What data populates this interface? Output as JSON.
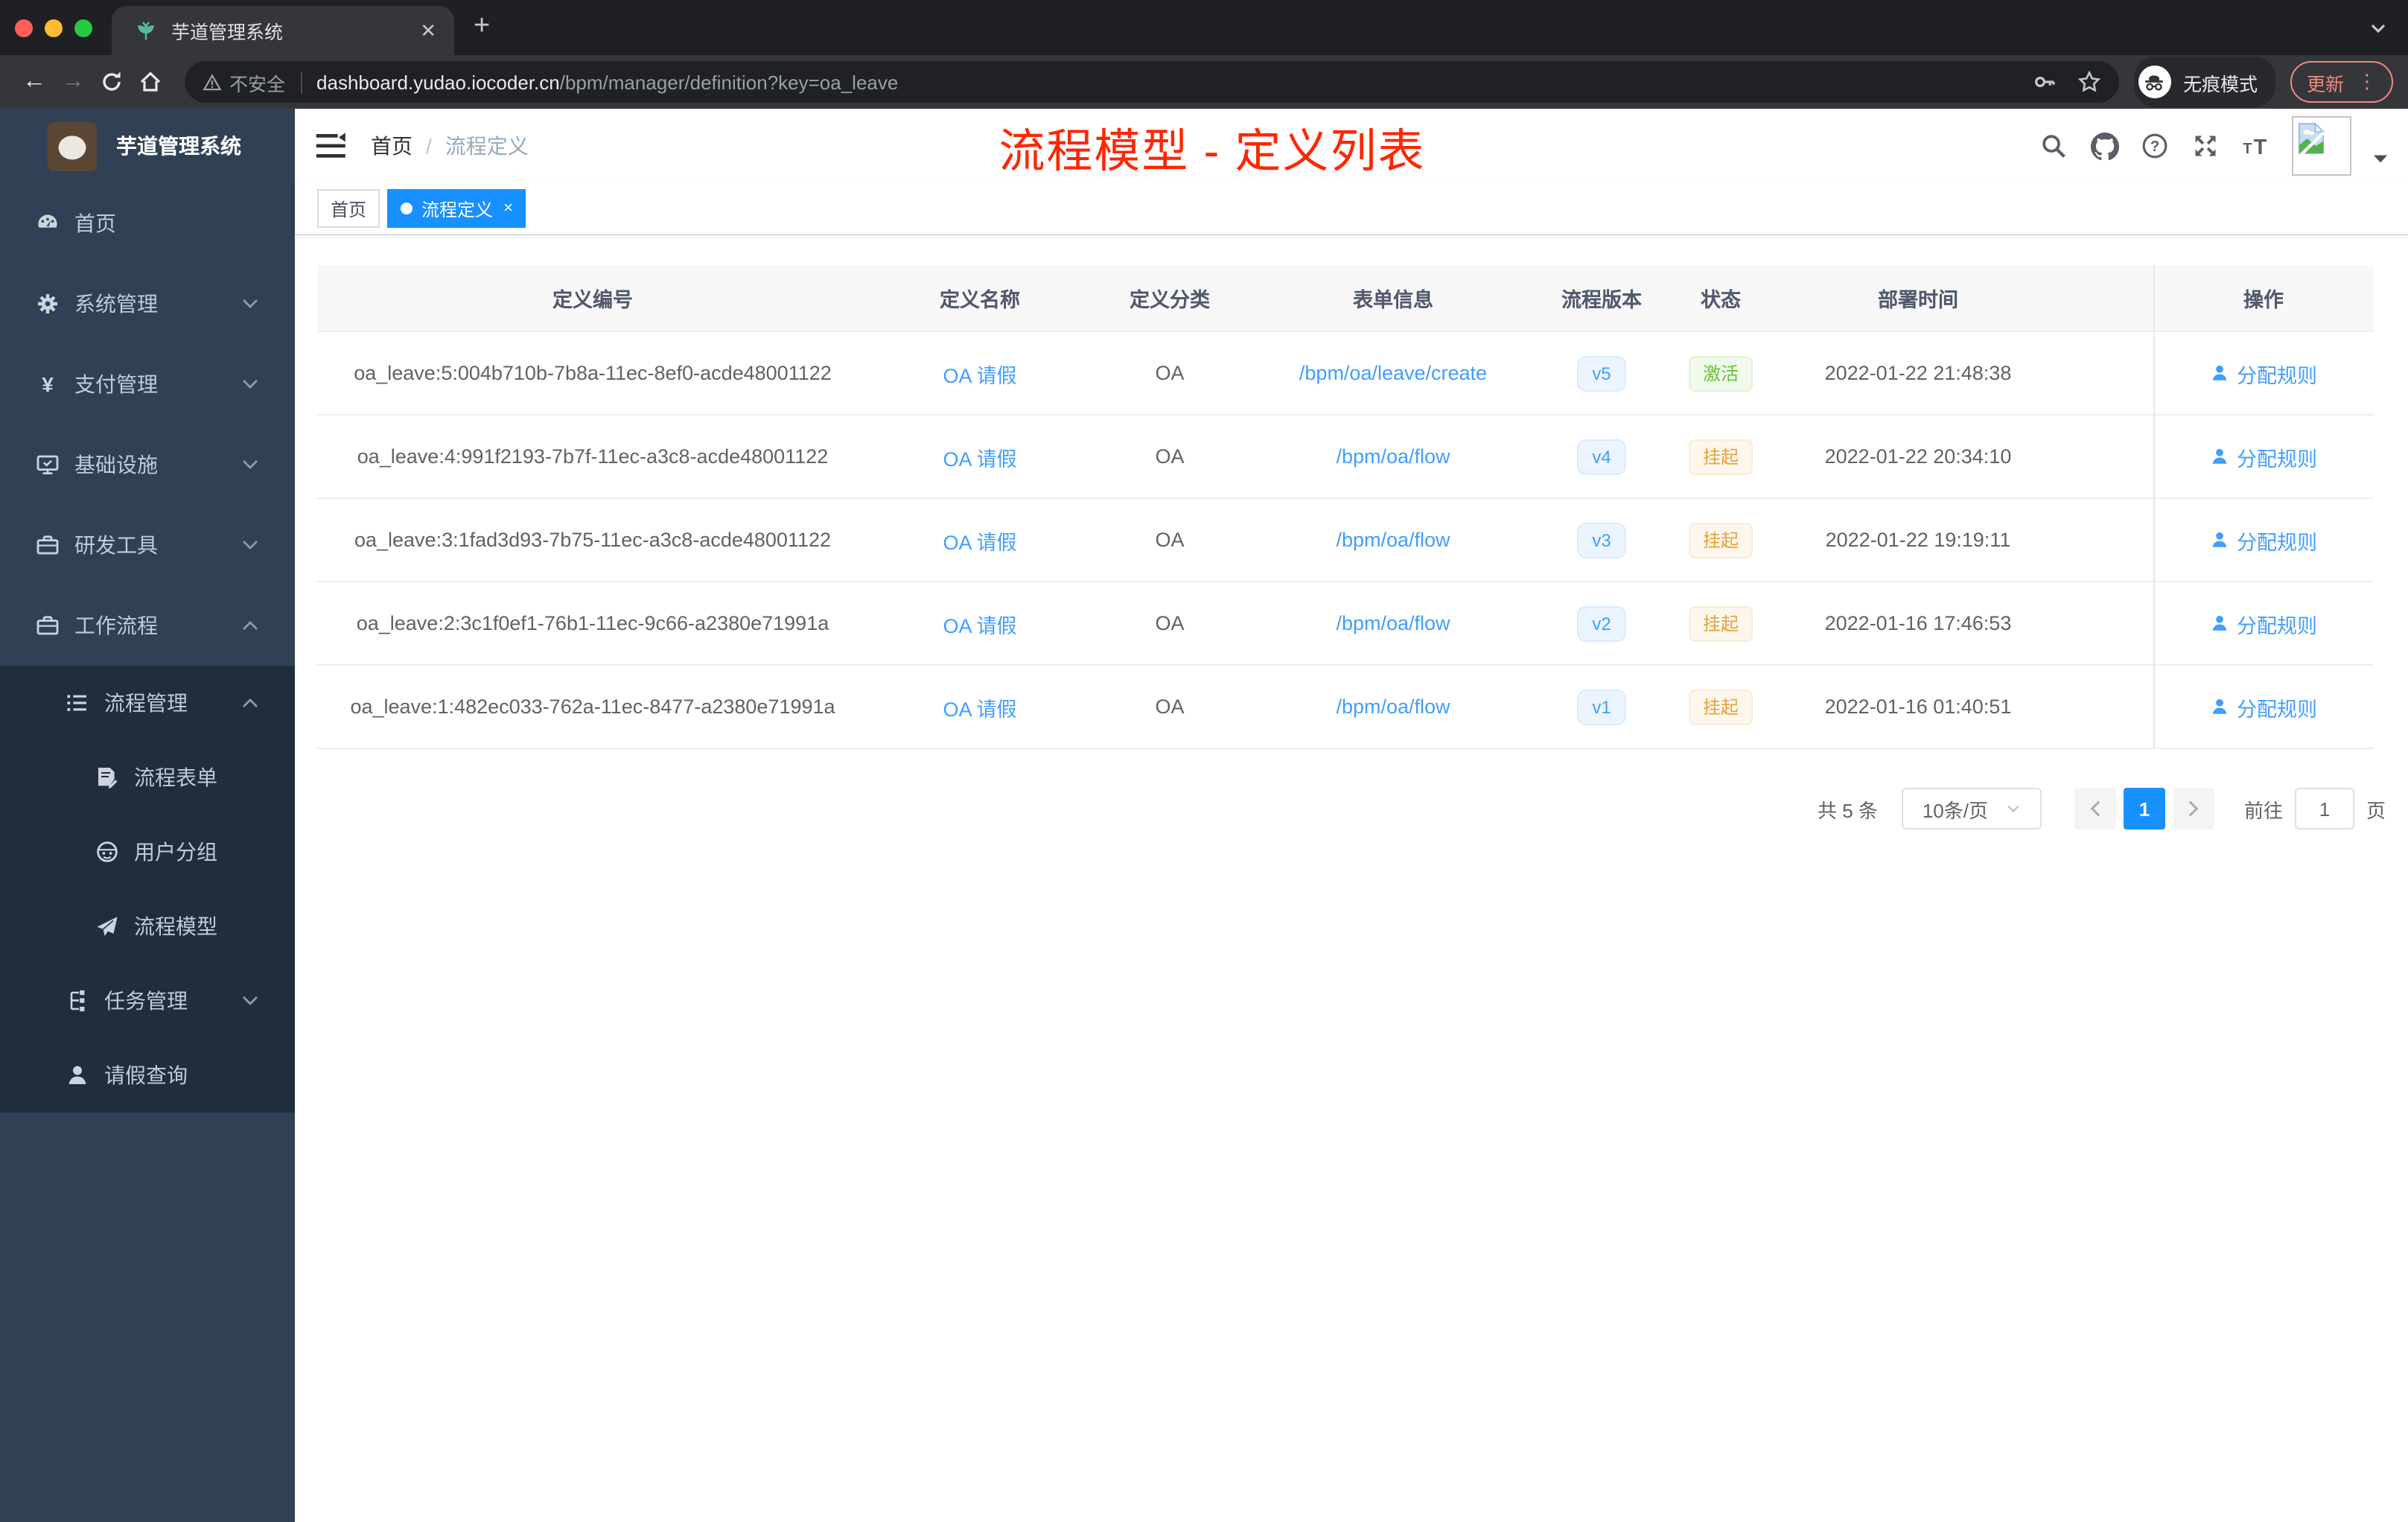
{
  "browser": {
    "tab_title": "芋道管理系统",
    "security_label": "不安全",
    "url_host": "dashboard.yudao.iocoder.cn",
    "url_path": "/bpm/manager/definition?key=oa_leave",
    "incognito_label": "无痕模式",
    "update_label": "更新"
  },
  "sidebar": {
    "app_title": "芋道管理系统",
    "items": [
      {
        "key": "home",
        "label": "首页",
        "icon": "dashboard-icon",
        "depth": 0,
        "sub": false,
        "chevron": null
      },
      {
        "key": "system-management",
        "label": "系统管理",
        "icon": "gear-icon",
        "depth": 0,
        "sub": false,
        "chevron": "down"
      },
      {
        "key": "payment-management",
        "label": "支付管理",
        "icon": "yen-icon",
        "depth": 0,
        "sub": false,
        "chevron": "down"
      },
      {
        "key": "infrastructure",
        "label": "基础设施",
        "icon": "monitor-icon",
        "depth": 0,
        "sub": false,
        "chevron": "down"
      },
      {
        "key": "dev-tools",
        "label": "研发工具",
        "icon": "toolbox-icon",
        "depth": 0,
        "sub": false,
        "chevron": "down"
      },
      {
        "key": "workflow",
        "label": "工作流程",
        "icon": "toolbox-icon",
        "depth": 0,
        "sub": false,
        "chevron": "up"
      },
      {
        "key": "process-management",
        "label": "流程管理",
        "icon": "list-tree-icon",
        "depth": 1,
        "sub": true,
        "chevron": "up"
      },
      {
        "key": "process-form",
        "label": "流程表单",
        "icon": "form-icon",
        "depth": 2,
        "sub": true,
        "chevron": null
      },
      {
        "key": "user-group",
        "label": "用户分组",
        "icon": "robot-icon",
        "depth": 2,
        "sub": true,
        "chevron": null
      },
      {
        "key": "process-model",
        "label": "流程模型",
        "icon": "paper-plane-icon",
        "depth": 2,
        "sub": true,
        "chevron": null
      },
      {
        "key": "task-management",
        "label": "任务管理",
        "icon": "org-tree-icon",
        "depth": 1,
        "sub": true,
        "chevron": "down"
      },
      {
        "key": "leave-query",
        "label": "请假查询",
        "icon": "person-icon",
        "depth": 1,
        "sub": true,
        "chevron": null
      }
    ]
  },
  "navbar": {
    "breadcrumb": {
      "home": "首页",
      "separator": "/",
      "current": "流程定义"
    },
    "page_banner": "流程模型 - 定义列表"
  },
  "tags": [
    {
      "label": "首页",
      "active": false,
      "closable": false
    },
    {
      "label": "流程定义",
      "active": true,
      "closable": true
    }
  ],
  "table": {
    "columns": [
      "定义编号",
      "定义名称",
      "定义分类",
      "表单信息",
      "流程版本",
      "状态",
      "部署时间",
      "操作"
    ],
    "action_label": "分配规则",
    "rows": [
      {
        "id": "oa_leave:5:004b710b-7b8a-11ec-8ef0-acde48001122",
        "name": "OA 请假",
        "category": "OA",
        "form": "/bpm/oa/leave/create",
        "version": "v5",
        "status": "激活",
        "status_type": "success",
        "deploy_time": "2022-01-22 21:48:38"
      },
      {
        "id": "oa_leave:4:991f2193-7b7f-11ec-a3c8-acde48001122",
        "name": "OA 请假",
        "category": "OA",
        "form": "/bpm/oa/flow",
        "version": "v4",
        "status": "挂起",
        "status_type": "warning",
        "deploy_time": "2022-01-22 20:34:10"
      },
      {
        "id": "oa_leave:3:1fad3d93-7b75-11ec-a3c8-acde48001122",
        "name": "OA 请假",
        "category": "OA",
        "form": "/bpm/oa/flow",
        "version": "v3",
        "status": "挂起",
        "status_type": "warning",
        "deploy_time": "2022-01-22 19:19:11"
      },
      {
        "id": "oa_leave:2:3c1f0ef1-76b1-11ec-9c66-a2380e71991a",
        "name": "OA 请假",
        "category": "OA",
        "form": "/bpm/oa/flow",
        "version": "v2",
        "status": "挂起",
        "status_type": "warning",
        "deploy_time": "2022-01-16 17:46:53"
      },
      {
        "id": "oa_leave:1:482ec033-762a-11ec-8477-a2380e71991a",
        "name": "OA 请假",
        "category": "OA",
        "form": "/bpm/oa/flow",
        "version": "v1",
        "status": "挂起",
        "status_type": "warning",
        "deploy_time": "2022-01-16 01:40:51"
      }
    ]
  },
  "pagination": {
    "total": "共 5 条",
    "page_size": "10条/页",
    "current_page": "1",
    "goto_label": "前往",
    "goto_value": "1",
    "unit_label": "页"
  },
  "colors": {
    "primary_link": "#409eff",
    "active_tag": "#1890ff",
    "banner_red": "#ff2600",
    "success": "#67c23a",
    "warning": "#e6a23c",
    "sidebar_bg": "#304156",
    "submenu_bg": "#1f2d3d"
  }
}
